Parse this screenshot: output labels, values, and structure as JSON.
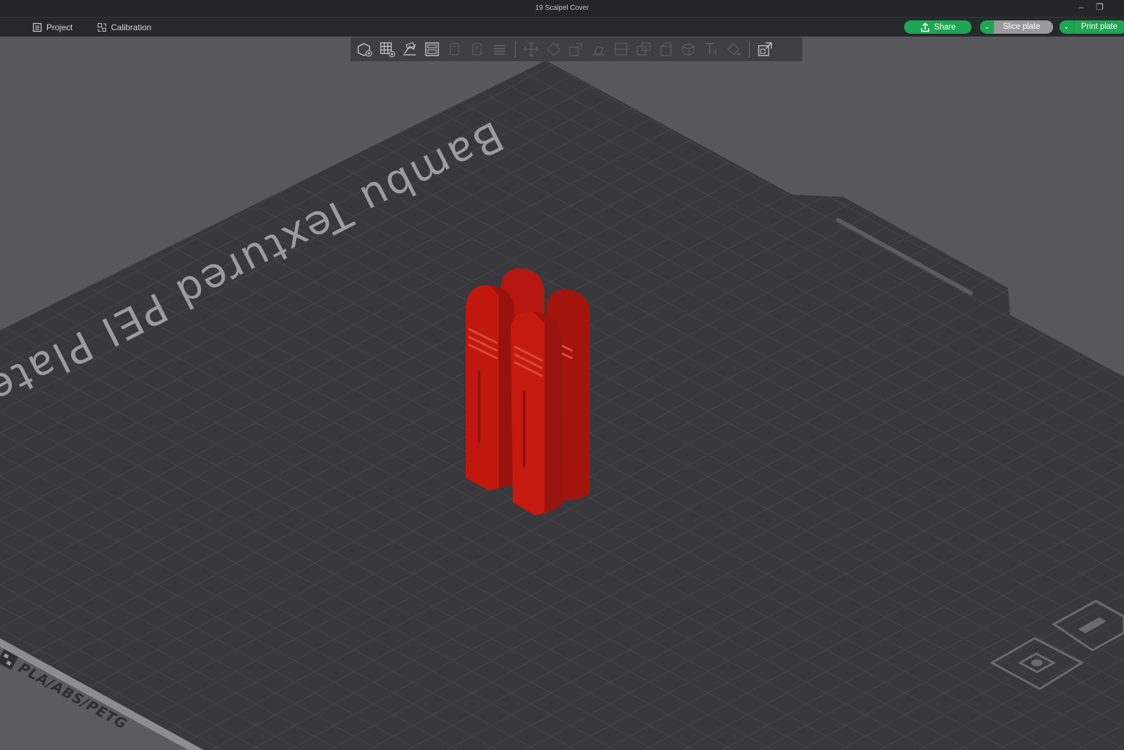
{
  "window": {
    "title": "19 Scalpel Cover"
  },
  "menu": {
    "project_label": "Project",
    "calibration_label": "Calibration"
  },
  "actions": {
    "share_label": "Share",
    "slice_label": "Slice plate",
    "print_label": "Print plate"
  },
  "plate": {
    "name": "Bambu Textured PEI Plate",
    "materials": "PLA/ABS/PETG"
  },
  "toolbar_icons": [
    "add-object-icon",
    "grid-add-icon",
    "auto-orient-icon",
    "arrange-icon",
    "split-objects-icon",
    "split-parts-icon",
    "layers-icon",
    "move-icon",
    "rotate-icon",
    "scale-icon",
    "lay-on-face-icon",
    "cut-icon",
    "support-paint-icon",
    "seam-paint-icon",
    "mesh-boolean-icon",
    "text-icon",
    "color-paint-icon",
    "assembly-view-icon"
  ],
  "colors": {
    "accent_green": "#1fa653",
    "model_red": "#c0180f",
    "bed": "#3a3a3e",
    "background": "#57575c"
  }
}
